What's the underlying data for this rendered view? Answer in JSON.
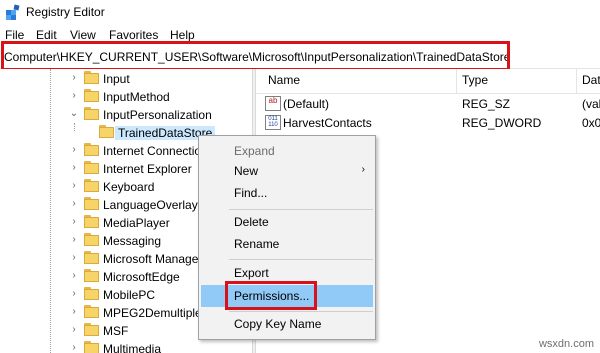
{
  "window": {
    "title": "Registry Editor",
    "app_icon": "registry-icon"
  },
  "menu": [
    "File",
    "Edit",
    "View",
    "Favorites",
    "Help"
  ],
  "address": {
    "path": "Computer\\HKEY_CURRENT_USER\\Software\\Microsoft\\InputPersonalization\\TrainedDataStore"
  },
  "tree": {
    "items": [
      {
        "label": "Input",
        "expander": "collapsed"
      },
      {
        "label": "InputMethod",
        "expander": "collapsed"
      },
      {
        "label": "InputPersonalization",
        "expander": "expanded"
      },
      {
        "label": "TrainedDataStore",
        "expander": "none",
        "selected": true
      },
      {
        "label": "Internet Connectio",
        "expander": "collapsed"
      },
      {
        "label": "Internet Explorer",
        "expander": "collapsed"
      },
      {
        "label": "Keyboard",
        "expander": "collapsed"
      },
      {
        "label": "LanguageOverlay",
        "expander": "collapsed"
      },
      {
        "label": "MediaPlayer",
        "expander": "collapsed"
      },
      {
        "label": "Messaging",
        "expander": "collapsed"
      },
      {
        "label": "Microsoft Manage",
        "expander": "collapsed"
      },
      {
        "label": "MicrosoftEdge",
        "expander": "collapsed"
      },
      {
        "label": "MobilePC",
        "expander": "collapsed"
      },
      {
        "label": "MPEG2Demultiple",
        "expander": "collapsed"
      },
      {
        "label": "MSF",
        "expander": "collapsed"
      },
      {
        "label": "Multimedia",
        "expander": "collapsed"
      }
    ]
  },
  "values": {
    "headers": {
      "name": "Name",
      "type": "Type",
      "data": "Dat"
    },
    "rows": [
      {
        "icon": "string-value-icon",
        "icon_text": "ab",
        "name": "(Default)",
        "type": "REG_SZ",
        "data": "(val"
      },
      {
        "icon": "binary-value-icon",
        "icon_text": "011 110",
        "name": "HarvestContacts",
        "type": "REG_DWORD",
        "data": "0x0"
      }
    ]
  },
  "context_menu": {
    "items": [
      {
        "label": "Expand",
        "disabled": true
      },
      {
        "label": "New",
        "submenu": true
      },
      {
        "label": "Find..."
      },
      {
        "separator": true
      },
      {
        "label": "Delete"
      },
      {
        "label": "Rename"
      },
      {
        "separator": true
      },
      {
        "label": "Export"
      },
      {
        "label": "Permissions...",
        "hovered": true
      },
      {
        "separator": true
      },
      {
        "label": "Copy Key Name"
      }
    ]
  },
  "watermark": "wsxdn.com",
  "colors": {
    "highlight_border": "#d9121a",
    "selection": "#cce8ff",
    "menu_hover": "#91c9f7"
  }
}
